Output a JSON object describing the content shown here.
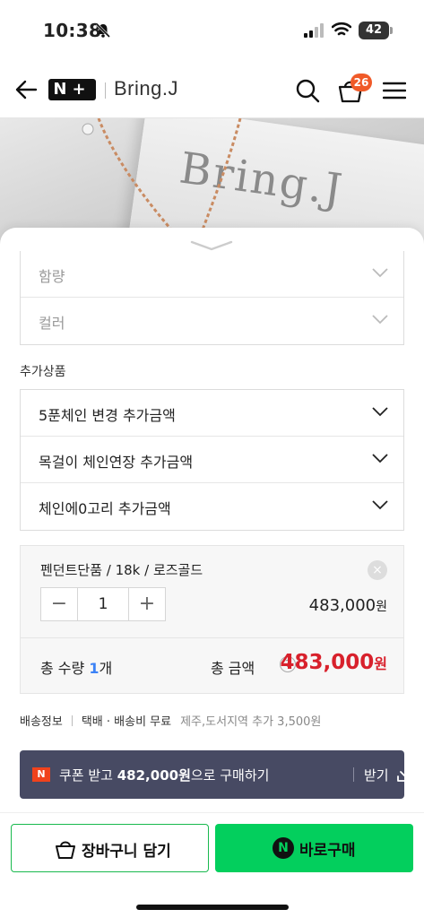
{
  "status_bar": {
    "time": "10:38",
    "battery": "42"
  },
  "header": {
    "logo": "N+",
    "brand": "Bring.J",
    "cart_count": "26"
  },
  "hero": {
    "engraving": "Bring.J"
  },
  "options": [
    {
      "label": "함량"
    },
    {
      "label": "컬러"
    }
  ],
  "addons": {
    "title": "추가상품",
    "items": [
      {
        "label": "5푼체인 변경 추가금액"
      },
      {
        "label": "목걸이 체인연장 추가금액"
      },
      {
        "label": "체인에0고리 추가금액"
      }
    ]
  },
  "selected": {
    "name": "펜던트단품 / 18k / 로즈골드",
    "close": "×",
    "minus": "−",
    "quantity": "1",
    "plus": "+",
    "price": "483,000",
    "price_unit": "원"
  },
  "total": {
    "quantity_label": "총 수량",
    "quantity_value": "1",
    "quantity_unit": "개",
    "amount_label": "총 금액",
    "help": "?",
    "amount_value": "483,000",
    "amount_unit": "원"
  },
  "shipping": {
    "title": "배송정보",
    "method": "택배 · 배송비 무료",
    "extra": "제주,도서지역 추가 3,500원"
  },
  "coupon": {
    "badge": "N",
    "text_prefix": "쿠폰 받고 ",
    "amount": "482,000원",
    "text_suffix": "으로 구매하기",
    "get": "받기"
  },
  "buttons": {
    "cart": "장바구니 담기",
    "buy_icon": "N",
    "buy": "바로구매"
  },
  "colors": {
    "accent_green": "#03cf5d",
    "price_red": "#d8212c",
    "coupon_bg": "#474a63",
    "badge_orange": "#f05a28"
  }
}
